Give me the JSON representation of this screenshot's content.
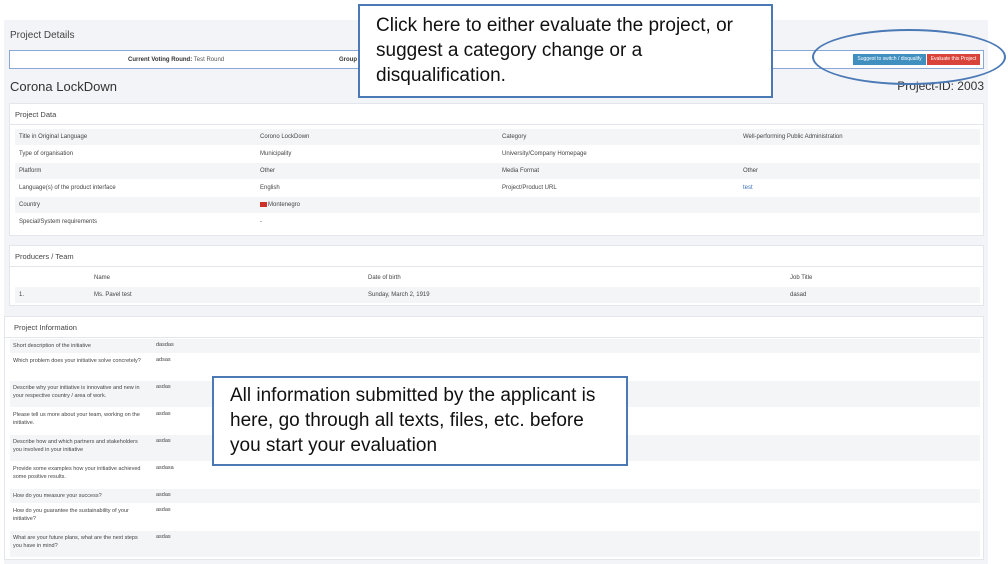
{
  "header": {
    "title": "Project Details"
  },
  "voting_bar": {
    "round_label": "Current Voting Round:",
    "round_value": "Test Round",
    "group_label": "Group"
  },
  "actions": {
    "switch_label": "Suggest to switch / disqualify",
    "evaluate_label": "Evaluate this Project"
  },
  "project": {
    "name": "Corona LockDown",
    "id_label": "Project-ID: 2003"
  },
  "project_data": {
    "title": "Project Data",
    "rows": [
      {
        "l1": "Title in Original Language",
        "v1": "Corono LockDown",
        "l2": "Category",
        "v2": "Well-performing Public Administration"
      },
      {
        "l1": "Type of organisation",
        "v1": "Municipality",
        "l2": "University/Company Homepage",
        "v2": ""
      },
      {
        "l1": "Platform",
        "v1": "Other",
        "l2": "Media Format",
        "v2": "Other"
      },
      {
        "l1": "Language(s) of the product interface",
        "v1": "English",
        "l2": "Project/Product URL",
        "v2": "test"
      },
      {
        "l1": "Country",
        "v1": "Montenegro",
        "l2": "",
        "v2": ""
      },
      {
        "l1": "Special/System requirements",
        "v1": "-",
        "l2": "",
        "v2": ""
      }
    ],
    "flag_color": "#d0302a",
    "link_color": "#3a6fb7"
  },
  "producers": {
    "title": "Producers / Team",
    "columns": [
      "Name",
      "Date of birth",
      "Job Title"
    ],
    "rows": [
      {
        "num": "1.",
        "name": "Ms. Pavel test",
        "dob": "Sunday, March 2, 1919",
        "job": "dasad"
      }
    ]
  },
  "project_info": {
    "title": "Project Information",
    "rows": [
      {
        "q": "Short description of the initiative",
        "a": "dasdas"
      },
      {
        "q": "Which problem does your initiative solve concretely?",
        "a": "adsas"
      },
      {
        "q": "Describe why your initiative is innovative and new in your respective country / area of work.",
        "a": "asdas"
      },
      {
        "q": "Please tell us more about your team, working on the initiative.",
        "a": "asdas"
      },
      {
        "q": "Describe how and which partners and stakeholders you involved in your initiative",
        "a": "asdas"
      },
      {
        "q": "Provide some examples how your initiative achieved some positive results.",
        "a": "asdasa"
      },
      {
        "q": "How do you measure your success?",
        "a": "asdas"
      },
      {
        "q": "How do you guarantee the sustainability of your initiative?",
        "a": "asdas"
      },
      {
        "q": "What are your future plans, what are the next steps you have in mind?",
        "a": "asdas"
      }
    ]
  },
  "annotations": {
    "callout_top": "Click here to either evaluate the project, or suggest a category change or a disqualification.",
    "callout_middle": "All information submitted by the applicant is here, go through all texts, files, etc. before you start your evaluation",
    "accent_color": "#4a79b6"
  },
  "colors": {
    "switch_button": "#3f8fbf",
    "evaluate_button": "#d9443a"
  }
}
